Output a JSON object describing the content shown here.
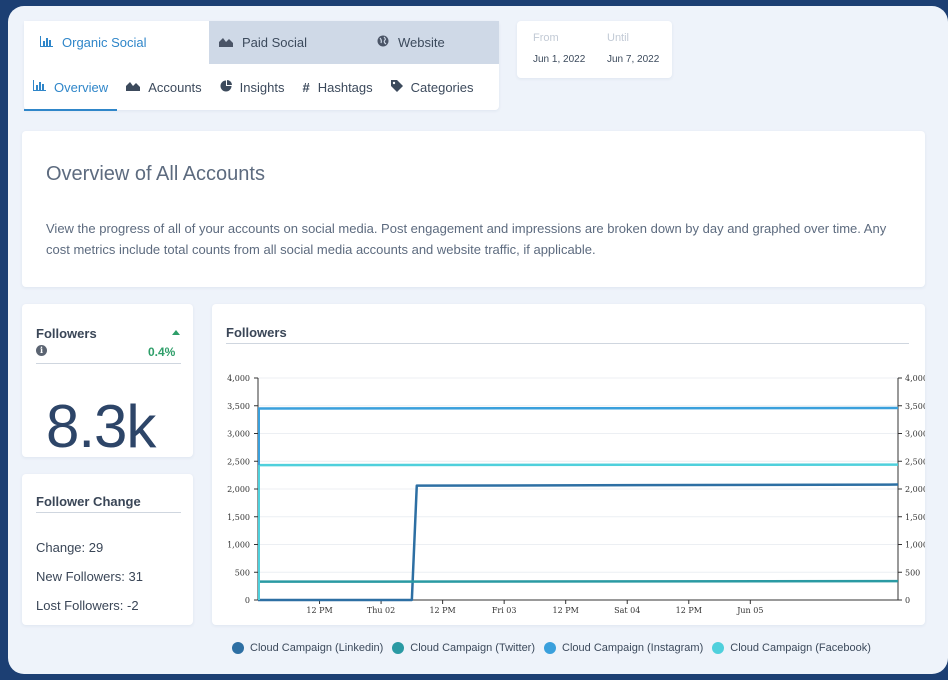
{
  "tabs_top": [
    {
      "label": "Organic Social",
      "icon": "bar-chart-icon"
    },
    {
      "label": "Paid Social",
      "icon": "area-chart-icon"
    },
    {
      "label": "Website",
      "icon": "globe-icon"
    }
  ],
  "tabs_sub": [
    {
      "label": "Overview",
      "icon": "bar-chart-icon"
    },
    {
      "label": "Accounts",
      "icon": "area-chart-icon"
    },
    {
      "label": "Insights",
      "icon": "pie-chart-icon"
    },
    {
      "label": "Hashtags",
      "icon": "hashtag-icon"
    },
    {
      "label": "Categories",
      "icon": "tag-icon"
    }
  ],
  "dates": {
    "from_label": "From",
    "from_value": "Jun 1, 2022",
    "until_label": "Until",
    "until_value": "Jun 7, 2022"
  },
  "overview": {
    "title": "Overview of All Accounts",
    "description": "View the progress of all of your accounts on social media. Post engagement and impressions are broken down by day and graphed over time. Any cost metrics include total counts from all social media accounts and website traffic, if applicable."
  },
  "followers_card": {
    "title": "Followers",
    "change_pct": "0.4%",
    "value": "8.3k",
    "trend": "up",
    "trend_color": "#2e9e69"
  },
  "follower_change": {
    "title": "Follower Change",
    "items": [
      "Change: 29",
      "New Followers: 31",
      "Lost Followers: -2"
    ]
  },
  "chart_title": "Followers",
  "legend": [
    {
      "label": "Cloud Campaign (Linkedin)",
      "color": "#2d6fa3"
    },
    {
      "label": "Cloud Campaign (Twitter)",
      "color": "#2a9aa3"
    },
    {
      "label": "Cloud Campaign (Instagram)",
      "color": "#3aa0dc"
    },
    {
      "label": "Cloud Campaign (Facebook)",
      "color": "#4fd0dc"
    }
  ],
  "chart_data": {
    "type": "line",
    "title": "Followers",
    "ylim": [
      0,
      4000
    ],
    "y_ticks": [
      "0",
      "500",
      "1,000",
      "1,500",
      "2,000",
      "2,500",
      "3,000",
      "3,500",
      "4,000"
    ],
    "y_tick_values": [
      0,
      500,
      1000,
      1500,
      2000,
      2500,
      3000,
      3500,
      4000
    ],
    "x_domain": [
      0,
      5.2
    ],
    "x_ticks": [
      {
        "label": "12 PM",
        "x": 0.5
      },
      {
        "label": "Thu 02",
        "x": 1.0
      },
      {
        "label": "12 PM",
        "x": 1.5
      },
      {
        "label": "Fri 03",
        "x": 2.0
      },
      {
        "label": "12 PM",
        "x": 2.5
      },
      {
        "label": "Sat 04",
        "x": 3.0
      },
      {
        "label": "12 PM",
        "x": 3.5
      },
      {
        "label": "Jun 05",
        "x": 4.0
      }
    ],
    "grid": true,
    "legend_position": "bottom",
    "series": [
      {
        "name": "Cloud Campaign (Linkedin)",
        "color": "#2d6fa3",
        "points": [
          [
            0,
            0
          ],
          [
            1.25,
            0
          ],
          [
            1.29,
            2060
          ],
          [
            5.2,
            2080
          ]
        ]
      },
      {
        "name": "Cloud Campaign (Twitter)",
        "color": "#2a9aa3",
        "points": [
          [
            0,
            330
          ],
          [
            5.2,
            340
          ]
        ]
      },
      {
        "name": "Cloud Campaign (Instagram)",
        "color": "#3aa0dc",
        "points": [
          [
            0,
            3450
          ],
          [
            5.2,
            3460
          ]
        ]
      },
      {
        "name": "Cloud Campaign (Facebook)",
        "color": "#4fd0dc",
        "points": [
          [
            0,
            2430
          ],
          [
            5.2,
            2440
          ]
        ]
      }
    ]
  }
}
